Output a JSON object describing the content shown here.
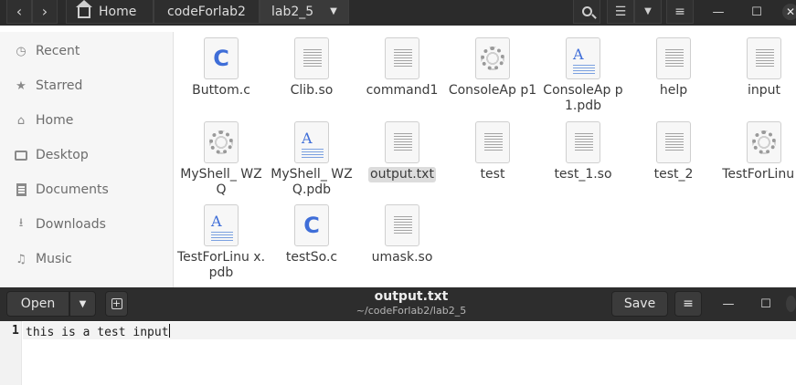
{
  "files_window": {
    "breadcrumbs": [
      "Home",
      "codeForlab2",
      "lab2_5"
    ],
    "icons": {
      "back": "chevron-left-icon",
      "forward": "chevron-right-icon",
      "home": "home-icon",
      "search": "search-icon",
      "view": "list-view-icon",
      "view_menu": "chevron-down-icon",
      "menu": "hamburger-icon"
    },
    "sidebar": [
      {
        "label": "Recent",
        "icon": "clock-icon"
      },
      {
        "label": "Starred",
        "icon": "star-icon"
      },
      {
        "label": "Home",
        "icon": "home-icon"
      },
      {
        "label": "Desktop",
        "icon": "desktop-icon"
      },
      {
        "label": "Documents",
        "icon": "document-icon"
      },
      {
        "label": "Downloads",
        "icon": "download-icon"
      },
      {
        "label": "Music",
        "icon": "music-icon"
      }
    ],
    "files": [
      {
        "name": "Buttom.c",
        "type": "c"
      },
      {
        "name": "Clib.so",
        "type": "text"
      },
      {
        "name": "command1",
        "type": "text"
      },
      {
        "name": "ConsoleAp p1",
        "type": "exec"
      },
      {
        "name": "ConsoleAp p1.pdb",
        "type": "pdb"
      },
      {
        "name": "help",
        "type": "text"
      },
      {
        "name": "input",
        "type": "text"
      },
      {
        "name": "MyShell_ WZQ",
        "type": "exec"
      },
      {
        "name": "MyShell_ WZQ.pdb",
        "type": "pdb"
      },
      {
        "name": "output.txt",
        "type": "text",
        "selected": true
      },
      {
        "name": "test",
        "type": "text"
      },
      {
        "name": "test_1.so",
        "type": "text"
      },
      {
        "name": "test_2",
        "type": "text"
      },
      {
        "name": "TestForLinu x",
        "type": "exec"
      },
      {
        "name": "TestForLinu x.pdb",
        "type": "pdb"
      },
      {
        "name": "testSo.c",
        "type": "c"
      },
      {
        "name": "umask.so",
        "type": "text"
      }
    ]
  },
  "editor": {
    "open_label": "Open",
    "title": "output.txt",
    "subtitle": "~/codeForlab2/lab2_5",
    "save_label": "Save",
    "line_number": "1",
    "line_text": "this is a test input"
  }
}
